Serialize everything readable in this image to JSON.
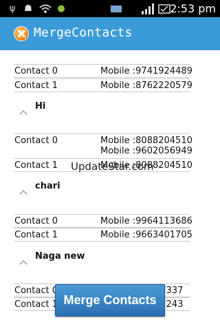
{
  "status_bar": {
    "time": "2:53 pm",
    "icons": [
      "usb-icon",
      "android-icon",
      "wifi-icon",
      "android-icon",
      "sd-card-icon",
      "signal-icon",
      "battery-icon"
    ]
  },
  "action_bar": {
    "title": "MergeContacts",
    "accent_color": "#3a9bd8"
  },
  "top_rows": [
    {
      "name": "Contact 0",
      "mobile": "Mobile :9741924489"
    },
    {
      "name": "Contact 1",
      "mobile": "Mobile :8762220579"
    }
  ],
  "groups": [
    {
      "title": "Hi",
      "rows": [
        {
          "name": "Contact 0",
          "mobiles": [
            "Mobile :8088204510",
            "Mobile :9602056949"
          ]
        },
        {
          "name": "Contact 1",
          "mobiles": [
            "Mobile :8088204510"
          ]
        }
      ]
    },
    {
      "title": "chari",
      "rows": [
        {
          "name": "Contact 0",
          "mobiles": [
            "Mobile :9964113686"
          ]
        },
        {
          "name": "Contact 1",
          "mobiles": [
            "Mobile :9663401705"
          ]
        }
      ]
    },
    {
      "title": "Naga new",
      "rows": [
        {
          "name": "Contact 0",
          "mobiles": [
            "77337"
          ]
        },
        {
          "name": "Contact 1",
          "mobiles": [
            "32243"
          ]
        }
      ]
    }
  ],
  "watermark": "UpdateStar.com",
  "merge_button": {
    "label": "Merge Contacts"
  }
}
